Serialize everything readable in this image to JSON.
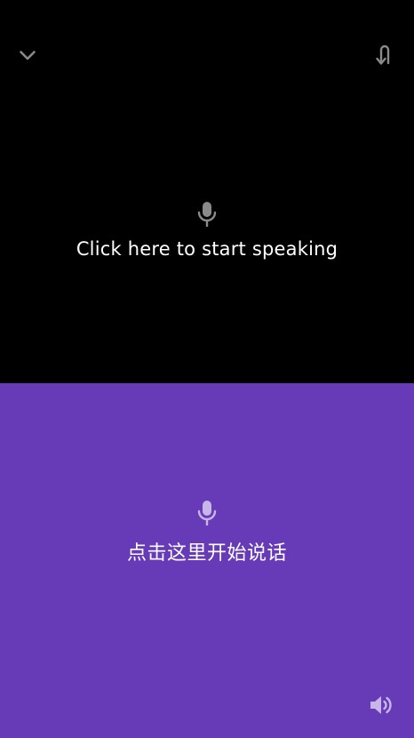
{
  "colors": {
    "top_background": "#000000",
    "bottom_background": "#673AB7",
    "top_icon": "#8A8A8A",
    "bottom_icon": "#C9B6E8",
    "text": "#FFFFFF"
  },
  "top_panel": {
    "collapse_icon": "chevron-down-icon",
    "swap_icon": "u-turn-arrow-icon",
    "mic_icon": "microphone-icon",
    "prompt": "Click here to start speaking"
  },
  "bottom_panel": {
    "mic_icon": "microphone-icon",
    "prompt": "点击这里开始说话",
    "speaker_icon": "speaker-volume-icon"
  }
}
